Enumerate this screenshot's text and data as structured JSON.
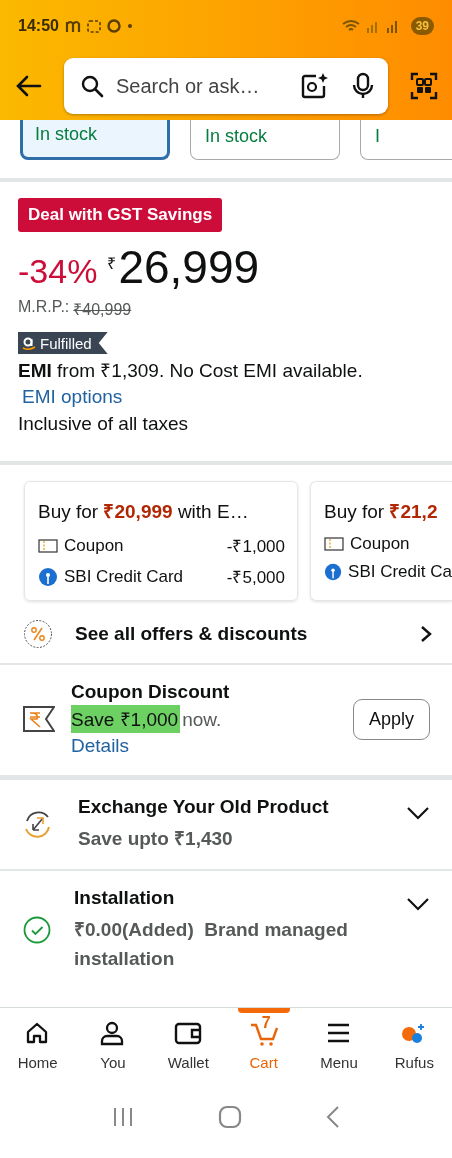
{
  "status_bar": {
    "time": "14:50",
    "battery": "39"
  },
  "search": {
    "placeholder": "Search or ask…"
  },
  "stock_options": [
    {
      "label": "In stock",
      "selected": true
    },
    {
      "label": "In stock",
      "selected": false
    },
    {
      "label": "I",
      "selected": false
    }
  ],
  "deal_badge": "Deal with GST Savings",
  "price": {
    "discount": "-34%",
    "currency": "₹",
    "amount": "26,999",
    "mrp_label": "M.R.P.:",
    "mrp": "₹40,999"
  },
  "fulfilled": "Fulfilled",
  "emi": "**EMI** from ₹1,309. No Cost EMI available.",
  "emi_link": "EMI options",
  "tax_note": "Inclusive of all taxes",
  "offers": [
    {
      "title": "Buy for **₹20,999** with E…",
      "lines": [
        {
          "kind": "coupon",
          "label": "Coupon",
          "amount": "-₹1,000"
        },
        {
          "kind": "bank",
          "label": "SBI Credit Card",
          "amount": "-₹5,000"
        }
      ]
    },
    {
      "title": "Buy for **₹21,2**",
      "lines": [
        {
          "kind": "coupon",
          "label": "Coupon"
        },
        {
          "kind": "bank",
          "label": "SBI Credit Ca"
        }
      ]
    }
  ],
  "all_offers": "See all offers & discounts",
  "coupon": {
    "title": "Coupon Discount",
    "save": "Save ₹1,000",
    "rest": "now.",
    "link": "Details",
    "button": "Apply"
  },
  "expanders": [
    {
      "kind": "exchange",
      "title": "Exchange Your Old Product",
      "subtitle": "Save upto ₹1,430",
      "expanded": false
    },
    {
      "kind": "installation",
      "title": "Installation",
      "subtitle": "₹0.00(Added)  Brand managed installation",
      "expanded": false
    }
  ],
  "nav": [
    {
      "kind": "home",
      "label": "Home",
      "selected": false
    },
    {
      "kind": "you",
      "label": "You",
      "selected": false
    },
    {
      "kind": "wallet",
      "label": "Wallet",
      "selected": false
    },
    {
      "kind": "cart",
      "label": "Cart",
      "selected": true,
      "badge": "7"
    },
    {
      "kind": "menu",
      "label": "Menu",
      "selected": false
    },
    {
      "kind": "rufus",
      "label": "Rufus",
      "selected": false
    }
  ]
}
